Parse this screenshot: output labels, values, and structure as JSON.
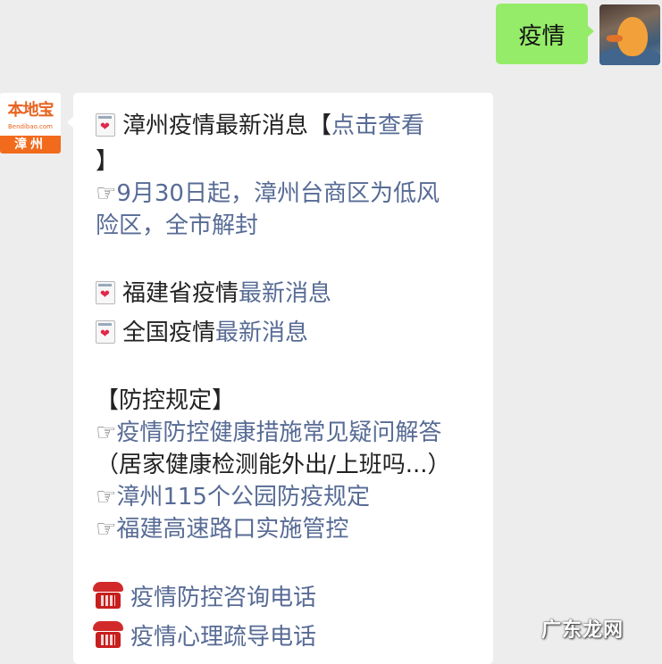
{
  "sent_message": {
    "text": "疫情"
  },
  "bot_avatar": {
    "brand": "本地宝",
    "domain": "Bendibao.com",
    "city": "漳州"
  },
  "message": {
    "latest_news": {
      "prefix": "漳州疫情最新消息【",
      "link": "点击查看",
      "suffix": "】"
    },
    "notice": {
      "bullet": "☞",
      "line1": "9月30日起，漳州台商区为低风",
      "line2": "险区，全市解封"
    },
    "fujian": {
      "prefix": "福建省疫情",
      "link": "最新消息"
    },
    "national": {
      "prefix": "全国疫情",
      "link": "最新消息"
    },
    "rules_header": "【防控规定】",
    "rules": {
      "faq_bullet": "☞",
      "faq_line1": "疫情防控健康措施常见疑问解答",
      "faq_line2": "（居家健康检测能外出/上班吗...）",
      "parks_bullet": "☞",
      "parks": "漳州115个公园防疫规定",
      "highway_bullet": "☞",
      "highway": "福建高速路口实施管控"
    },
    "hotline_consult": "疫情防控咨询电话",
    "hotline_psych": "疫情心理疏导电话"
  },
  "watermark": "广东龙网",
  "icons": {
    "memo": "memo-heart-icon",
    "phone": "telephone-icon",
    "pointer": "pointing-hand-icon"
  },
  "colors": {
    "link": "#576b95",
    "sent_bubble": "#95ec69",
    "background": "#ededed"
  }
}
